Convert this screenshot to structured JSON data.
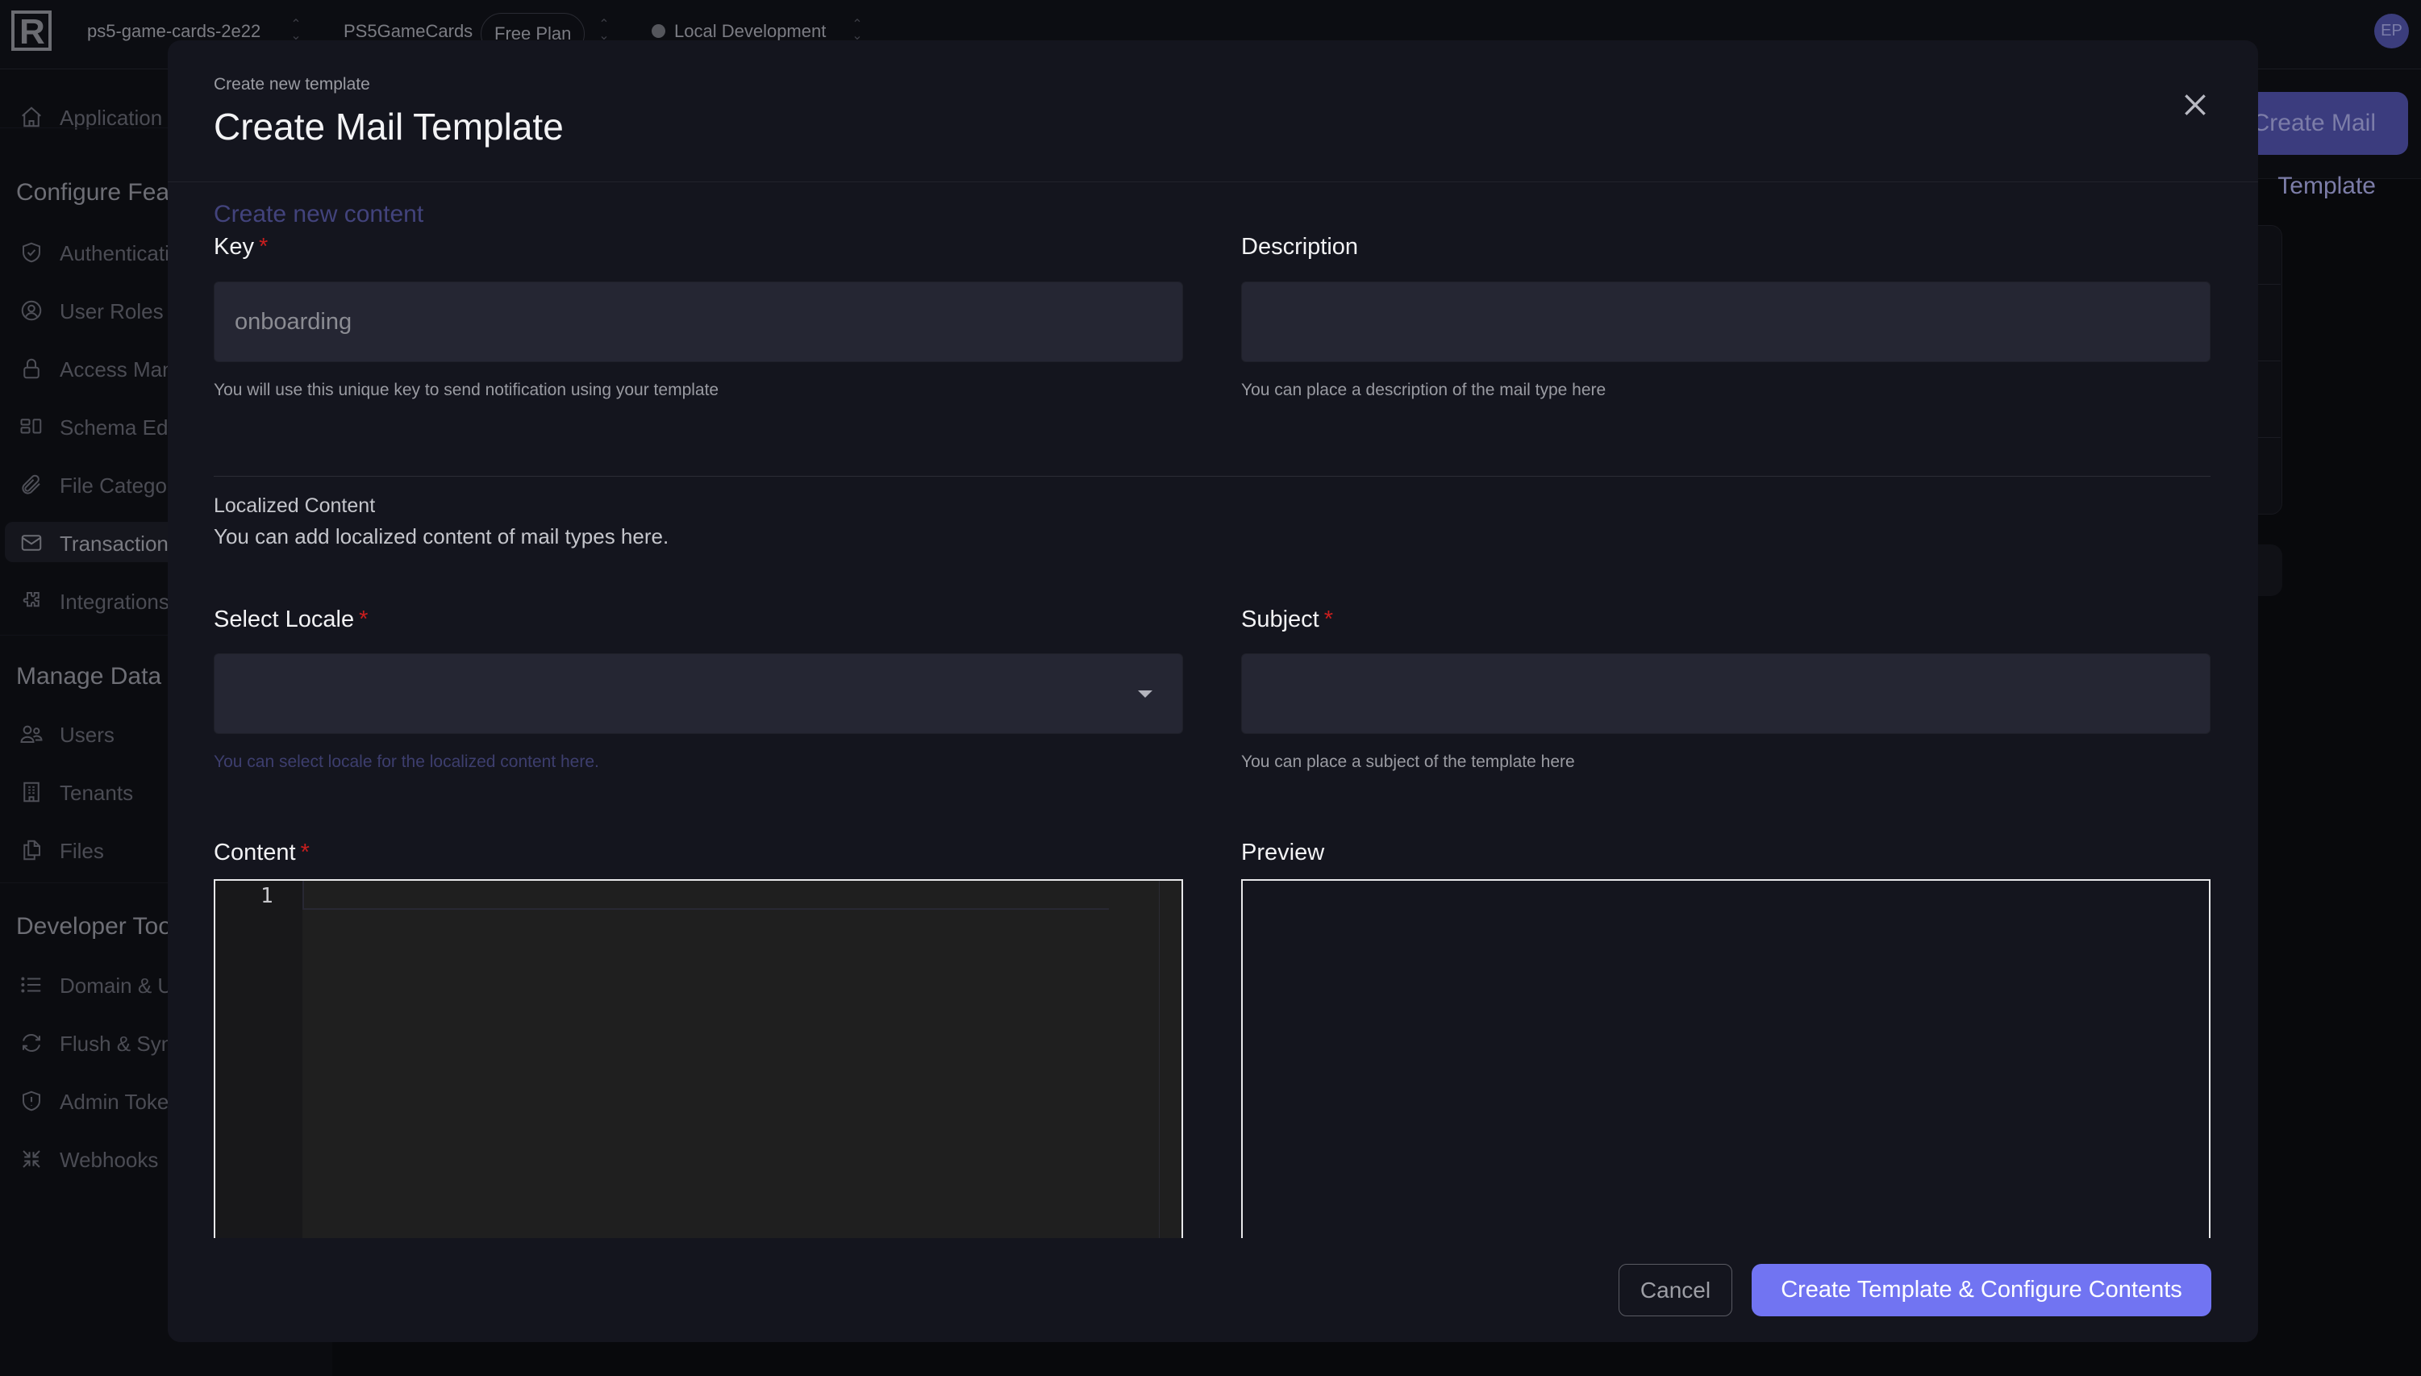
{
  "topbar": {
    "logo": "R",
    "project": "ps5-game-cards-2e22",
    "app": "PS5GameCards",
    "plan": "Free Plan",
    "environment": "Local Development",
    "avatar_initials": "EP"
  },
  "sidebar": {
    "top_item": {
      "label": "Application",
      "icon": "home-icon"
    },
    "sections": [
      {
        "title": "Configure Features",
        "items": [
          {
            "label": "Authentication",
            "icon": "shield-check-icon"
          },
          {
            "label": "User Roles",
            "icon": "user-circle-icon"
          },
          {
            "label": "Access Management",
            "icon": "lock-icon"
          },
          {
            "label": "Schema Editor",
            "icon": "schema-icon"
          },
          {
            "label": "File Categories",
            "icon": "paperclip-icon"
          },
          {
            "label": "Transactional Mails",
            "icon": "mail-icon",
            "active": true
          },
          {
            "label": "Integrations",
            "icon": "puzzle-icon"
          }
        ]
      },
      {
        "title": "Manage Data",
        "items": [
          {
            "label": "Users",
            "icon": "users-icon"
          },
          {
            "label": "Tenants",
            "icon": "building-icon"
          },
          {
            "label": "Files",
            "icon": "files-icon"
          }
        ]
      },
      {
        "title": "Developer Tools",
        "items": [
          {
            "label": "Domain & URLs",
            "icon": "list-icon"
          },
          {
            "label": "Flush & Sync",
            "icon": "refresh-icon"
          },
          {
            "label": "Admin Tokens",
            "icon": "shield-alert-icon"
          },
          {
            "label": "Webhooks",
            "icon": "arrows-in-icon"
          }
        ]
      }
    ]
  },
  "background": {
    "primary_button": "Create Mail Template"
  },
  "modal": {
    "subtitle": "Create new template",
    "title": "Create Mail Template",
    "create_content_link": "Create new content",
    "key": {
      "label": "Key",
      "required": "*",
      "value": "onboarding",
      "help": "You will use this unique key to send notification using your template"
    },
    "description": {
      "label": "Description",
      "value": "",
      "help": "You can place a description of the mail type here"
    },
    "localized": {
      "title": "Localized Content",
      "description": "You can add localized content of mail types here."
    },
    "locale": {
      "label": "Select Locale",
      "required": "*",
      "value": "",
      "help": "You can select locale for the localized content here."
    },
    "subject": {
      "label": "Subject",
      "required": "*",
      "value": "",
      "help": "You can place a subject of the template here"
    },
    "content": {
      "label": "Content",
      "required": "*",
      "line_number": "1"
    },
    "preview": {
      "label": "Preview"
    },
    "cancel_label": "Cancel",
    "submit_label": "Create Template & Configure Contents"
  },
  "colors": {
    "accent": "#7174f2",
    "required": "#c81e1e",
    "modal_bg": "#14151e",
    "input_bg": "#252633"
  }
}
